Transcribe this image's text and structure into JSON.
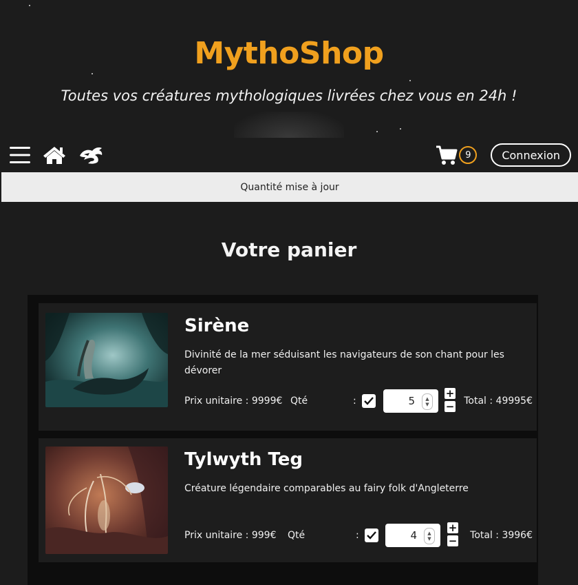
{
  "brand": "MythoShop",
  "tagline": "Toutes vos créatures mythologiques livrées chez vous en 24h !",
  "nav": {
    "cart_count": "9",
    "login_label": "Connexion"
  },
  "notice": "Quantité mise à jour",
  "cart_title": "Votre panier",
  "items": [
    {
      "name": "Sirène",
      "description": "Divinité de la mer séduisant les navigateurs de son chant pour les dévorer",
      "price": "Prix unitaire : 9999€",
      "qte_label": "Qté",
      "colon": ":",
      "quantity": "5",
      "total": "Total : 49995€"
    },
    {
      "name": "Tylwyth Teg",
      "description": "Créature légendaire comparables au fairy folk d'Angleterre",
      "price": "Prix unitaire : 999€",
      "qte_label": "Qté",
      "colon": ":",
      "quantity": "4",
      "total": "Total : 3996€"
    }
  ],
  "colors": {
    "accent": "#f0a01e",
    "background": "#1c1c1c",
    "notice_bg": "#ececec"
  },
  "icons": [
    "menu-icon",
    "home-icon",
    "dragon-icon",
    "cart-icon",
    "check-icon",
    "plus-icon",
    "minus-icon"
  ]
}
